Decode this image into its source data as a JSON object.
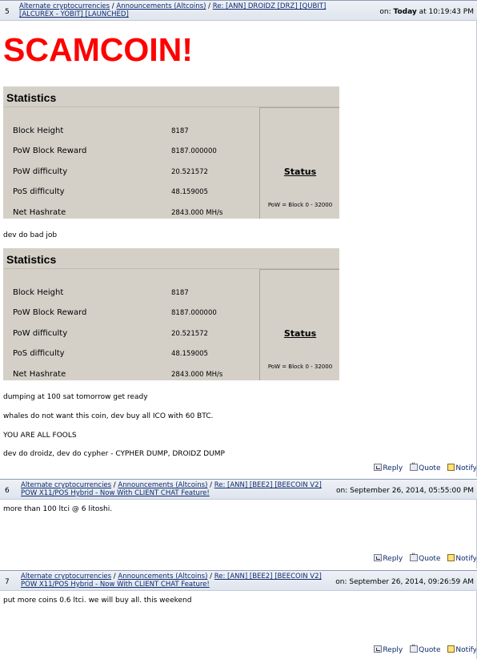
{
  "posts": [
    {
      "number": "5",
      "crumbs": [
        "Alternate cryptocurrencies",
        "Announcements (Altcoins)",
        "Re: [ANN] DROIDZ [DRZ] [QUBIT] [ALCUREX - YOBIT] [LAUNCHED]"
      ],
      "date_prefix": "on: ",
      "date_bold": "Today",
      "date_rest": " at 10:19:43 PM",
      "headline": "SCAMCOIN!",
      "lines": [
        "dev do bad job",
        "dumping at 100 sat tomorrow get ready",
        "whales do not want this coin, dev buy all ICO with 60 BTC.",
        "YOU ARE ALL FOOLS",
        "dev do droidz, dev do cypher - CYPHER DUMP, DROIDZ DUMP"
      ]
    },
    {
      "number": "6",
      "crumbs": [
        "Alternate cryptocurrencies",
        "Announcements (Altcoins)",
        "Re: [ANN] [BEE2] [BEECOIN V2] POW X11/POS Hybrid - Now With CLIENT CHAT Feature!"
      ],
      "date": "on: September 26, 2014, 05:55:00 PM",
      "body": "more than 100 ltci @ 6 litoshi."
    },
    {
      "number": "7",
      "crumbs": [
        "Alternate cryptocurrencies",
        "Announcements (Altcoins)",
        "Re: [ANN] [BEE2] [BEECOIN V2] POW X11/POS Hybrid - Now With CLIENT CHAT Feature!"
      ],
      "date": "on: September 26, 2014, 09:26:59 AM",
      "body": "put more coins 0.6 ltci. we will buy all. this weekend"
    }
  ],
  "stats": {
    "title": "Statistics",
    "rows": [
      {
        "label": "Block Height",
        "value": "8187"
      },
      {
        "label": "PoW Block Reward",
        "value": "8187.000000"
      },
      {
        "label": "PoW difficulty",
        "value": "20.521572"
      },
      {
        "label": "PoS difficulty",
        "value": "48.159005"
      },
      {
        "label": "Net Hashrate",
        "value": "2843.000 MH/s"
      }
    ],
    "status": "Status",
    "pow_note": "PoW = Block 0 - 32000"
  },
  "actions": {
    "reply": "Reply",
    "quote": "Quote",
    "notify": "Notify"
  },
  "breadcrumb_separator": " / "
}
